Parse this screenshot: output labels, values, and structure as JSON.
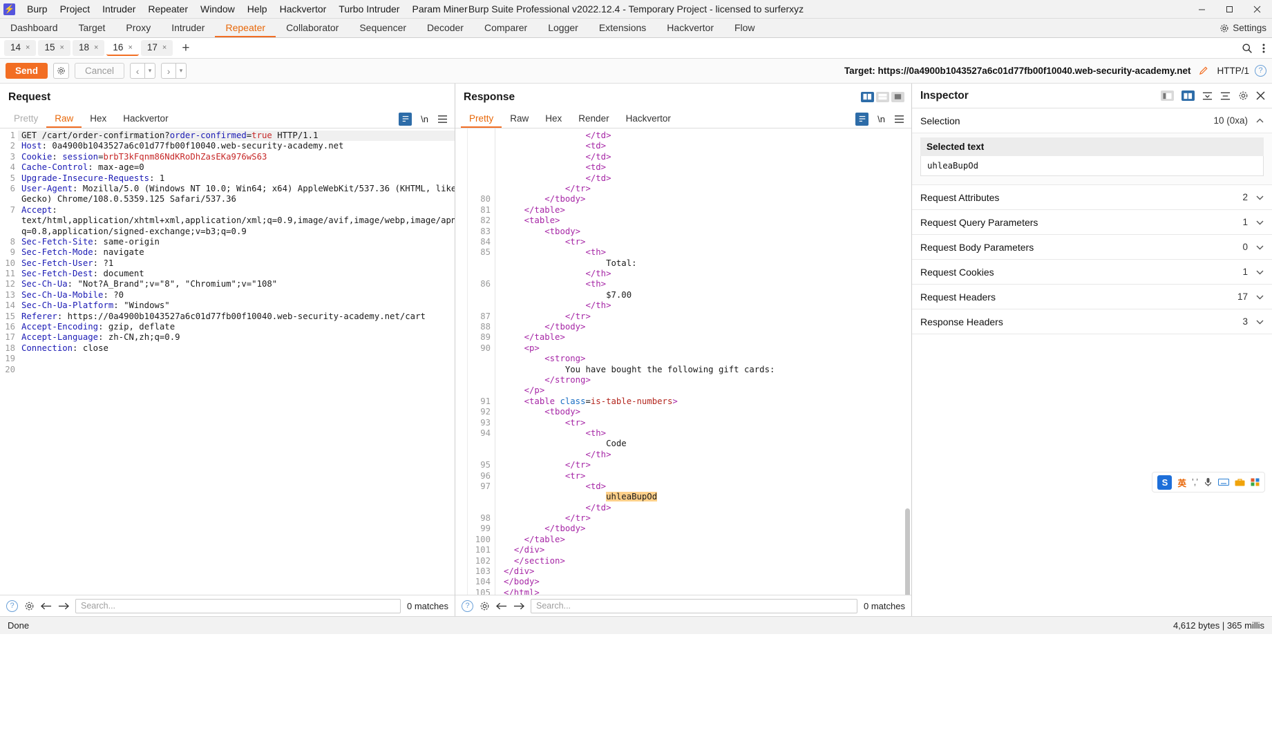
{
  "titlebar": {
    "logo": "burp-logo",
    "menus": [
      "Burp",
      "Project",
      "Intruder",
      "Repeater",
      "Window",
      "Help",
      "Hackvertor",
      "Turbo Intruder",
      "Param Miner"
    ],
    "title": "Burp Suite Professional v2022.12.4 - Temporary Project - licensed to surferxyz",
    "minimize": "─",
    "maximize": "☐",
    "close": "✕"
  },
  "main_tabs": {
    "items": [
      "Dashboard",
      "Target",
      "Proxy",
      "Intruder",
      "Repeater",
      "Collaborator",
      "Sequencer",
      "Decoder",
      "Comparer",
      "Logger",
      "Extensions",
      "Hackvertor",
      "Flow"
    ],
    "active": "Repeater",
    "settings_label": "Settings",
    "accent": "#f26e23"
  },
  "repeater_tabs": {
    "items": [
      {
        "label": "14",
        "close": "×"
      },
      {
        "label": "15",
        "close": "×"
      },
      {
        "label": "18",
        "close": "×"
      },
      {
        "label": "16",
        "close": "×"
      },
      {
        "label": "17",
        "close": "×"
      }
    ],
    "active_index": 3,
    "add": "+"
  },
  "sendbar": {
    "send_label": "Send",
    "cancel_label": "Cancel",
    "back": "‹",
    "forward": "›",
    "caret": "▾",
    "target_label": "Target:",
    "target_url": "https://0a4900b1043527a6c01d77fb00f10040.web-security-academy.net",
    "http_version": "HTTP/1",
    "help": "?"
  },
  "request": {
    "title": "Request",
    "tabs": [
      "Pretty",
      "Raw",
      "Hex",
      "Hackvertor"
    ],
    "active_tab": "Raw",
    "newline_label": "\\n",
    "lines": [
      {
        "n": "1",
        "first": true,
        "parts": [
          {
            "t": "GET /cart/order-confirmation?",
            "c": "txt"
          },
          {
            "t": "order-confirmed",
            "c": "blu"
          },
          {
            "t": "=",
            "c": "txt"
          },
          {
            "t": "true",
            "c": "red"
          },
          {
            "t": " HTTP/1.1",
            "c": "txt"
          }
        ]
      },
      {
        "n": "2",
        "parts": [
          {
            "t": "Host",
            "c": "hdr"
          },
          {
            "t": ": 0a4900b1043527a6c01d77fb00f10040.web-security-academy.net",
            "c": "txt"
          }
        ]
      },
      {
        "n": "3",
        "parts": [
          {
            "t": "Cookie",
            "c": "hdr"
          },
          {
            "t": ": ",
            "c": "txt"
          },
          {
            "t": "session",
            "c": "blu"
          },
          {
            "t": "=",
            "c": "txt"
          },
          {
            "t": "brbT3kFqnm86NdKRoDhZasEKa976wS63",
            "c": "red"
          }
        ]
      },
      {
        "n": "4",
        "parts": [
          {
            "t": "Cache-Control",
            "c": "hdr"
          },
          {
            "t": ": max-age=0",
            "c": "txt"
          }
        ]
      },
      {
        "n": "5",
        "parts": [
          {
            "t": "Upgrade-Insecure-Requests",
            "c": "hdr"
          },
          {
            "t": ": 1",
            "c": "txt"
          }
        ]
      },
      {
        "n": "6",
        "parts": [
          {
            "t": "User-Agent",
            "c": "hdr"
          },
          {
            "t": ": Mozilla/5.0 (Windows NT 10.0; Win64; x64) AppleWebKit/537.36 (KHTML, like",
            "c": "txt"
          }
        ]
      },
      {
        "n": "",
        "parts": [
          {
            "t": "Gecko) Chrome/108.0.5359.125 Safari/537.36",
            "c": "txt"
          }
        ]
      },
      {
        "n": "7",
        "parts": [
          {
            "t": "Accept",
            "c": "hdr"
          },
          {
            "t": ":",
            "c": "txt"
          }
        ]
      },
      {
        "n": "",
        "parts": [
          {
            "t": "text/html,application/xhtml+xml,application/xml;q=0.9,image/avif,image/webp,image/apng,*/*;",
            "c": "txt"
          }
        ]
      },
      {
        "n": "",
        "parts": [
          {
            "t": "q=0.8,application/signed-exchange;v=b3;q=0.9",
            "c": "txt"
          }
        ]
      },
      {
        "n": "8",
        "parts": [
          {
            "t": "Sec-Fetch-Site",
            "c": "hdr"
          },
          {
            "t": ": same-origin",
            "c": "txt"
          }
        ]
      },
      {
        "n": "9",
        "parts": [
          {
            "t": "Sec-Fetch-Mode",
            "c": "hdr"
          },
          {
            "t": ": navigate",
            "c": "txt"
          }
        ]
      },
      {
        "n": "10",
        "parts": [
          {
            "t": "Sec-Fetch-User",
            "c": "hdr"
          },
          {
            "t": ": ?1",
            "c": "txt"
          }
        ]
      },
      {
        "n": "11",
        "parts": [
          {
            "t": "Sec-Fetch-Dest",
            "c": "hdr"
          },
          {
            "t": ": document",
            "c": "txt"
          }
        ]
      },
      {
        "n": "12",
        "parts": [
          {
            "t": "Sec-Ch-Ua",
            "c": "hdr"
          },
          {
            "t": ": \"Not?A_Brand\";v=\"8\", \"Chromium\";v=\"108\"",
            "c": "txt"
          }
        ]
      },
      {
        "n": "13",
        "parts": [
          {
            "t": "Sec-Ch-Ua-Mobile",
            "c": "hdr"
          },
          {
            "t": ": ?0",
            "c": "txt"
          }
        ]
      },
      {
        "n": "14",
        "parts": [
          {
            "t": "Sec-Ch-Ua-Platform",
            "c": "hdr"
          },
          {
            "t": ": \"Windows\"",
            "c": "txt"
          }
        ]
      },
      {
        "n": "15",
        "parts": [
          {
            "t": "Referer",
            "c": "hdr"
          },
          {
            "t": ": https://0a4900b1043527a6c01d77fb00f10040.web-security-academy.net/cart",
            "c": "txt"
          }
        ]
      },
      {
        "n": "16",
        "parts": [
          {
            "t": "Accept-Encoding",
            "c": "hdr"
          },
          {
            "t": ": gzip, deflate",
            "c": "txt"
          }
        ]
      },
      {
        "n": "17",
        "parts": [
          {
            "t": "Accept-Language",
            "c": "hdr"
          },
          {
            "t": ": zh-CN,zh;q=0.9",
            "c": "txt"
          }
        ]
      },
      {
        "n": "18",
        "parts": [
          {
            "t": "Connection",
            "c": "hdr"
          },
          {
            "t": ": close",
            "c": "txt"
          }
        ]
      },
      {
        "n": "19",
        "parts": []
      },
      {
        "n": "20",
        "parts": []
      }
    ],
    "search_placeholder": "Search...",
    "matches": "0 matches"
  },
  "response": {
    "title": "Response",
    "tabs": [
      "Pretty",
      "Raw",
      "Hex",
      "Render",
      "Hackvertor"
    ],
    "active_tab": "Pretty",
    "newline_label": "\\n",
    "lines": [
      {
        "n": "",
        "indent": 8,
        "parts": [
          {
            "t": "</td>",
            "c": "tag"
          }
        ]
      },
      {
        "n": "",
        "indent": 8,
        "parts": [
          {
            "t": "<td>",
            "c": "tag"
          }
        ]
      },
      {
        "n": "",
        "indent": 8,
        "parts": [
          {
            "t": "</td>",
            "c": "tag"
          }
        ]
      },
      {
        "n": "",
        "indent": 8,
        "parts": [
          {
            "t": "<td>",
            "c": "tag"
          }
        ]
      },
      {
        "n": "",
        "indent": 8,
        "parts": [
          {
            "t": "</td>",
            "c": "tag"
          }
        ]
      },
      {
        "n": "",
        "indent": 6,
        "parts": [
          {
            "t": "</tr>",
            "c": "tag"
          }
        ]
      },
      {
        "n": "80",
        "indent": 4,
        "parts": [
          {
            "t": "</tbody>",
            "c": "tag"
          }
        ]
      },
      {
        "n": "81",
        "indent": 2,
        "parts": [
          {
            "t": "</table>",
            "c": "tag"
          }
        ]
      },
      {
        "n": "82",
        "indent": 2,
        "parts": [
          {
            "t": "<table>",
            "c": "tag"
          }
        ]
      },
      {
        "n": "83",
        "indent": 4,
        "parts": [
          {
            "t": "<tbody>",
            "c": "tag"
          }
        ]
      },
      {
        "n": "84",
        "indent": 6,
        "parts": [
          {
            "t": "<tr>",
            "c": "tag"
          }
        ]
      },
      {
        "n": "85",
        "indent": 8,
        "parts": [
          {
            "t": "<th>",
            "c": "tag"
          }
        ]
      },
      {
        "n": "",
        "indent": 10,
        "parts": [
          {
            "t": "Total:",
            "c": "txt"
          }
        ]
      },
      {
        "n": "",
        "indent": 8,
        "parts": [
          {
            "t": "</th>",
            "c": "tag"
          }
        ]
      },
      {
        "n": "86",
        "indent": 8,
        "parts": [
          {
            "t": "<th>",
            "c": "tag"
          }
        ]
      },
      {
        "n": "",
        "indent": 10,
        "parts": [
          {
            "t": "$7.00",
            "c": "txt"
          }
        ]
      },
      {
        "n": "",
        "indent": 8,
        "parts": [
          {
            "t": "</th>",
            "c": "tag"
          }
        ]
      },
      {
        "n": "87",
        "indent": 6,
        "parts": [
          {
            "t": "</tr>",
            "c": "tag"
          }
        ]
      },
      {
        "n": "88",
        "indent": 4,
        "parts": [
          {
            "t": "</tbody>",
            "c": "tag"
          }
        ]
      },
      {
        "n": "89",
        "indent": 2,
        "parts": [
          {
            "t": "</table>",
            "c": "tag"
          }
        ]
      },
      {
        "n": "90",
        "indent": 2,
        "parts": [
          {
            "t": "<p>",
            "c": "tag"
          }
        ]
      },
      {
        "n": "",
        "indent": 4,
        "parts": [
          {
            "t": "<strong>",
            "c": "tag"
          }
        ]
      },
      {
        "n": "",
        "indent": 6,
        "parts": [
          {
            "t": "You have bought the following gift cards:",
            "c": "txt"
          }
        ]
      },
      {
        "n": "",
        "indent": 4,
        "parts": [
          {
            "t": "</strong>",
            "c": "tag"
          }
        ]
      },
      {
        "n": "",
        "indent": 2,
        "parts": [
          {
            "t": "</p>",
            "c": "tag"
          }
        ]
      },
      {
        "n": "91",
        "indent": 2,
        "parts": [
          {
            "t": "<table ",
            "c": "tag"
          },
          {
            "t": "class",
            "c": "attr"
          },
          {
            "t": "=",
            "c": "txt"
          },
          {
            "t": "is-table-numbers",
            "c": "attrval"
          },
          {
            "t": ">",
            "c": "tag"
          }
        ]
      },
      {
        "n": "92",
        "indent": 4,
        "parts": [
          {
            "t": "<tbody>",
            "c": "tag"
          }
        ]
      },
      {
        "n": "93",
        "indent": 6,
        "parts": [
          {
            "t": "<tr>",
            "c": "tag"
          }
        ]
      },
      {
        "n": "94",
        "indent": 8,
        "parts": [
          {
            "t": "<th>",
            "c": "tag"
          }
        ]
      },
      {
        "n": "",
        "indent": 10,
        "parts": [
          {
            "t": "Code",
            "c": "txt"
          }
        ]
      },
      {
        "n": "",
        "indent": 8,
        "parts": [
          {
            "t": "</th>",
            "c": "tag"
          }
        ]
      },
      {
        "n": "95",
        "indent": 6,
        "parts": [
          {
            "t": "</tr>",
            "c": "tag"
          }
        ]
      },
      {
        "n": "96",
        "indent": 6,
        "parts": [
          {
            "t": "<tr>",
            "c": "tag"
          }
        ]
      },
      {
        "n": "97",
        "indent": 8,
        "parts": [
          {
            "t": "<td>",
            "c": "tag"
          }
        ]
      },
      {
        "n": "",
        "indent": 10,
        "parts": [
          {
            "t": "uhleaBupOd",
            "c": "hl"
          }
        ]
      },
      {
        "n": "",
        "indent": 8,
        "parts": [
          {
            "t": "</td>",
            "c": "tag"
          }
        ]
      },
      {
        "n": "98",
        "indent": 6,
        "parts": [
          {
            "t": "</tr>",
            "c": "tag"
          }
        ]
      },
      {
        "n": "99",
        "indent": 4,
        "parts": [
          {
            "t": "</tbody>",
            "c": "tag"
          }
        ]
      },
      {
        "n": "100",
        "indent": 2,
        "parts": [
          {
            "t": "</table>",
            "c": "tag"
          }
        ]
      },
      {
        "n": "101",
        "indent": 1,
        "parts": [
          {
            "t": "</div>",
            "c": "tag"
          }
        ]
      },
      {
        "n": "102",
        "indent": 1,
        "parts": [
          {
            "t": "</section>",
            "c": "tag"
          }
        ]
      },
      {
        "n": "103",
        "indent": 0,
        "parts": [
          {
            "t": "</div>",
            "c": "tag"
          }
        ]
      },
      {
        "n": "104",
        "indent": 0,
        "parts": [
          {
            "t": "</body>",
            "c": "tag"
          }
        ]
      },
      {
        "n": "105",
        "indent": 0,
        "parts": [
          {
            "t": "</html>",
            "c": "tag"
          }
        ]
      },
      {
        "n": "106",
        "indent": 0,
        "parts": []
      }
    ],
    "search_placeholder": "Search...",
    "matches": "0 matches"
  },
  "inspector": {
    "title": "Inspector",
    "selection_label": "Selection",
    "selection_value": "10 (0xa)",
    "selected_text_label": "Selected text",
    "selected_text_value": "uhleaBupOd",
    "sections": [
      {
        "label": "Request Attributes",
        "count": "2"
      },
      {
        "label": "Request Query Parameters",
        "count": "1"
      },
      {
        "label": "Request Body Parameters",
        "count": "0"
      },
      {
        "label": "Request Cookies",
        "count": "1"
      },
      {
        "label": "Request Headers",
        "count": "17"
      },
      {
        "label": "Response Headers",
        "count": "3"
      }
    ],
    "chevron_down": "⌄",
    "chevron_up": "⌃"
  },
  "ime": {
    "logo": "S",
    "lang": "英",
    "items": [
      "’,’",
      "mic-icon",
      "keyboard-icon",
      "toolbox-icon",
      "menu-icon"
    ]
  },
  "statusbar": {
    "left": "Done",
    "right": "4,612 bytes | 365 millis"
  }
}
